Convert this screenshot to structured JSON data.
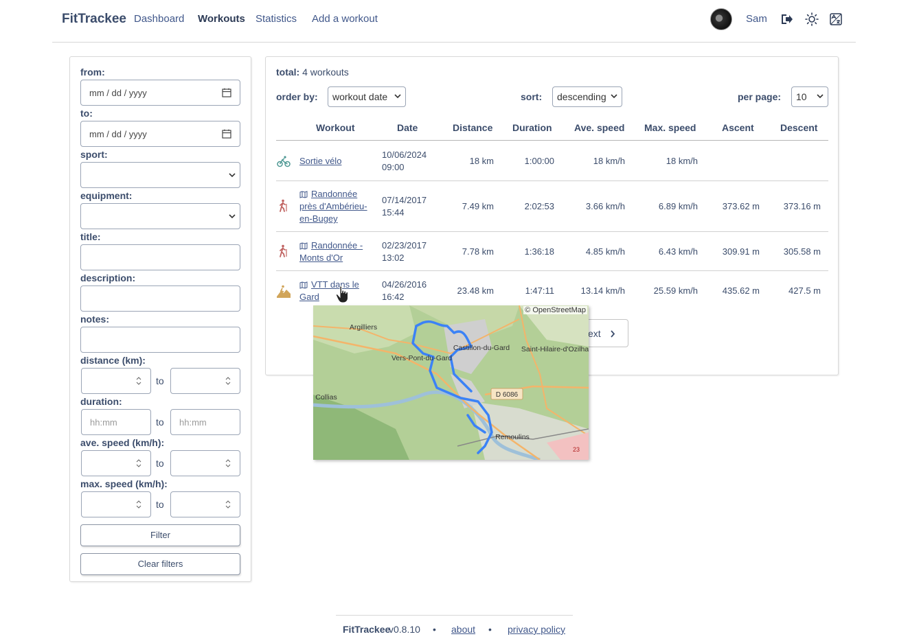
{
  "nav": {
    "brand": "FitTrackee",
    "links": [
      "Dashboard",
      "Workouts",
      "Statistics",
      "Add a workout"
    ],
    "active": "Workouts",
    "username": "Sam"
  },
  "filters": {
    "from_label": "from:",
    "from_placeholder": "mm / dd / yyyy",
    "to_label": "to:",
    "to_placeholder": "mm / dd / yyyy",
    "sport_label": "sport:",
    "equipment_label": "equipment:",
    "title_label": "title:",
    "description_label": "description:",
    "notes_label": "notes:",
    "distance_label": "distance (km):",
    "duration_label": "duration:",
    "duration_placeholder": "hh:mm",
    "ave_speed_label": "ave. speed (km/h):",
    "max_speed_label": "max. speed (km/h):",
    "to_word": "to",
    "filter_button": "Filter",
    "clear_button": "Clear filters"
  },
  "list": {
    "total_label": "total:",
    "total_value": "4 workouts",
    "order_by_label": "order by:",
    "order_by_value": "workout date",
    "sort_label": "sort:",
    "sort_value": "descending",
    "per_page_label": "per page:",
    "per_page_value": "10",
    "columns": [
      "Workout",
      "Date",
      "Distance",
      "Duration",
      "Ave. speed",
      "Max. speed",
      "Ascent",
      "Descent"
    ],
    "rows": [
      {
        "sport": "cycling-icon",
        "title": "Sortie vélo",
        "has_map": false,
        "date": "10/06/2024",
        "time": "09:00",
        "distance": "18 km",
        "duration": "1:00:00",
        "ave_speed": "18 km/h",
        "max_speed": "18 km/h",
        "ascent": "",
        "descent": ""
      },
      {
        "sport": "hiking-icon",
        "title": "Randonnée près d'Ambérieu-en-Bugey",
        "title_lines": [
          "Randonnée",
          "près d'Ambérieu-",
          "en-Bugey"
        ],
        "has_map": true,
        "date": "07/14/2017",
        "time": "15:44",
        "distance": "7.49 km",
        "duration": "2:02:53",
        "ave_speed": "3.66 km/h",
        "max_speed": "6.89 km/h",
        "ascent": "373.62 m",
        "descent": "373.16 m"
      },
      {
        "sport": "hiking-icon",
        "title": "Randonnée - Monts d'Or",
        "title_lines": [
          "Randonnée -",
          "Monts d'Or"
        ],
        "has_map": true,
        "date": "02/23/2017",
        "time": "13:02",
        "distance": "7.78 km",
        "duration": "1:36:18",
        "ave_speed": "4.85 km/h",
        "max_speed": "6.43 km/h",
        "ascent": "309.91 m",
        "descent": "305.58 m"
      },
      {
        "sport": "mountain-biking-icon",
        "title": "VTT dans le Gard",
        "title_lines": [
          "VTT dans le",
          "Gard"
        ],
        "has_map": true,
        "date": "04/26/2016",
        "time": "16:42",
        "distance": "23.48 km",
        "duration": "1:47:11",
        "ave_speed": "13.14 km/h",
        "max_speed": "25.59 km/h",
        "ascent": "435.62 m",
        "descent": "427.5 m"
      }
    ],
    "next_label": "ext"
  },
  "map_preview": {
    "credit": "© OpenStreetMap",
    "places": [
      "Argilliers",
      "Vers-Pont-du-Gard",
      "Castillon-du-Gard",
      "Saint-Hilaire-d'Ozilhan",
      "Collias",
      "D 6086",
      "Remoulins",
      "23"
    ]
  },
  "footer": {
    "app": "FitTrackee",
    "version": "v0.8.10",
    "about": "about",
    "privacy": "privacy policy"
  },
  "colors": {
    "link": "#40578a",
    "cycling": "#4c9792",
    "hiking": "#c06361",
    "mtb": "#d1a55a",
    "route": "#3b82f6"
  }
}
